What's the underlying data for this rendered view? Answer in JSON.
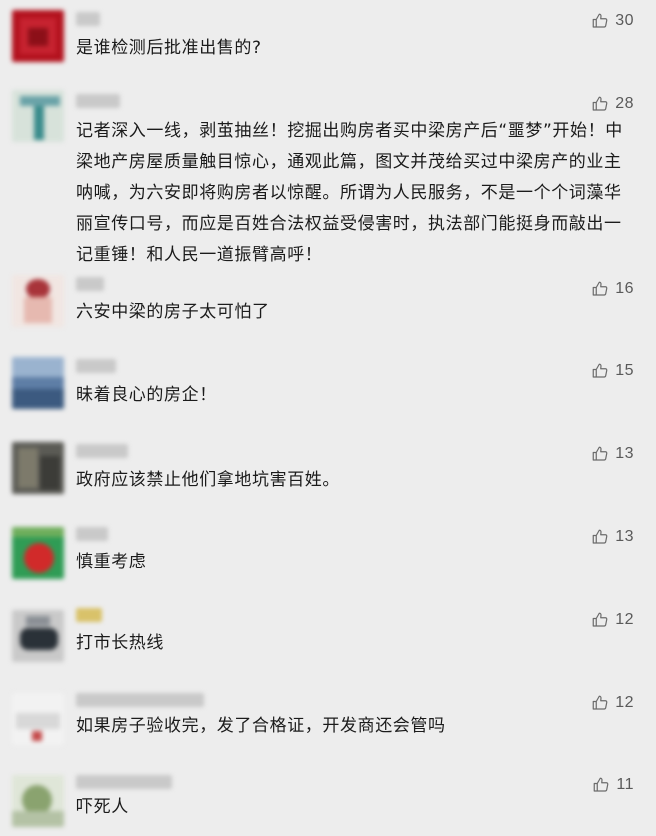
{
  "comments": [
    {
      "nickname": "",
      "avatar_colors": [
        "#b3121e",
        "#c72330",
        "#8c0f18"
      ],
      "text": "是谁检测后批准出售的?",
      "likes": "30"
    },
    {
      "nickname": "",
      "avatar_colors": [
        "#d7e2da",
        "#3a8c8c",
        "#6aa3a8"
      ],
      "text": "记者深入一线，剥茧抽丝！挖掘出购房者买中梁房产后“噩梦”开始！中梁地产房屋质量触目惊心，通观此篇，图文并茂给买过中梁房产的业主呐喊，为六安即将购房者以惊醒。所谓为人民服务，不是一个个词藻华丽宣传口号，而应是百姓合法权益受侵害时，执法部门能挺身而敲出一记重锤！和人民一道振臂高呼！",
      "likes": "28"
    },
    {
      "nickname": "",
      "avatar_colors": [
        "#f1e6e2",
        "#a8343a",
        "#e6b9b0"
      ],
      "text": "六安中梁的房子太可怕了",
      "likes": "16"
    },
    {
      "nickname": "",
      "avatar_colors": [
        "#5e7ea6",
        "#9ab3cf",
        "#3c5a80"
      ],
      "text": "昧着良心的房企！",
      "likes": "15"
    },
    {
      "nickname": "",
      "avatar_colors": [
        "#5b5b55",
        "#7d7a6b",
        "#3c3c38"
      ],
      "text": "政府应该禁止他们拿地坑害百姓。",
      "likes": "13"
    },
    {
      "nickname": "",
      "avatar_colors": [
        "#2f9c55",
        "#d12a2a",
        "#6fae5c"
      ],
      "text": "慎重考虑",
      "likes": "13"
    },
    {
      "nickname": "",
      "avatar_colors": [
        "#c9c9c9",
        "#2a3138",
        "#8a8f95"
      ],
      "text": "打市长热线",
      "likes": "12"
    },
    {
      "nickname": "",
      "avatar_colors": [
        "#f2f2f2",
        "#d8d8d8",
        "#c44a4a"
      ],
      "text": "如果房子验收完，发了合格证，开发商还会管吗",
      "likes": "12"
    },
    {
      "nickname": "",
      "avatar_colors": [
        "#dfe6d8",
        "#8aa36f",
        "#b4c2a5"
      ],
      "text": "吓死人",
      "likes": "11"
    }
  ],
  "colors": {
    "like_icon": "#6b6b6b",
    "background": "#ededed"
  },
  "icons": {
    "like": "thumbs-up-icon"
  }
}
